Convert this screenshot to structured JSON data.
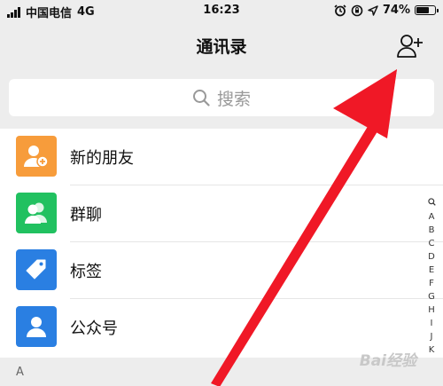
{
  "status_bar": {
    "carrier": "中国电信",
    "network": "4G",
    "time": "16:23",
    "battery": "74%",
    "battery_level": 0.74
  },
  "header": {
    "title": "通讯录",
    "add_icon": "add-contact-icon"
  },
  "search": {
    "placeholder": "搜索",
    "icon": "search-icon"
  },
  "contacts": {
    "items": [
      {
        "label": "新的朋友",
        "icon": "new-friend-icon",
        "color": "#f79c3b"
      },
      {
        "label": "群聊",
        "icon": "group-chat-icon",
        "color": "#21c160"
      },
      {
        "label": "标签",
        "icon": "tag-icon",
        "color": "#2a7fe2"
      },
      {
        "label": "公众号",
        "icon": "official-account-icon",
        "color": "#2a7fe2"
      }
    ],
    "section_header": "A"
  },
  "index_bar": [
    "Q",
    "A",
    "B",
    "C",
    "D",
    "E",
    "F",
    "G",
    "H",
    "I",
    "J",
    "K"
  ],
  "annotation": {
    "arrow_color": "#f01826"
  },
  "watermark": "Bai经验"
}
